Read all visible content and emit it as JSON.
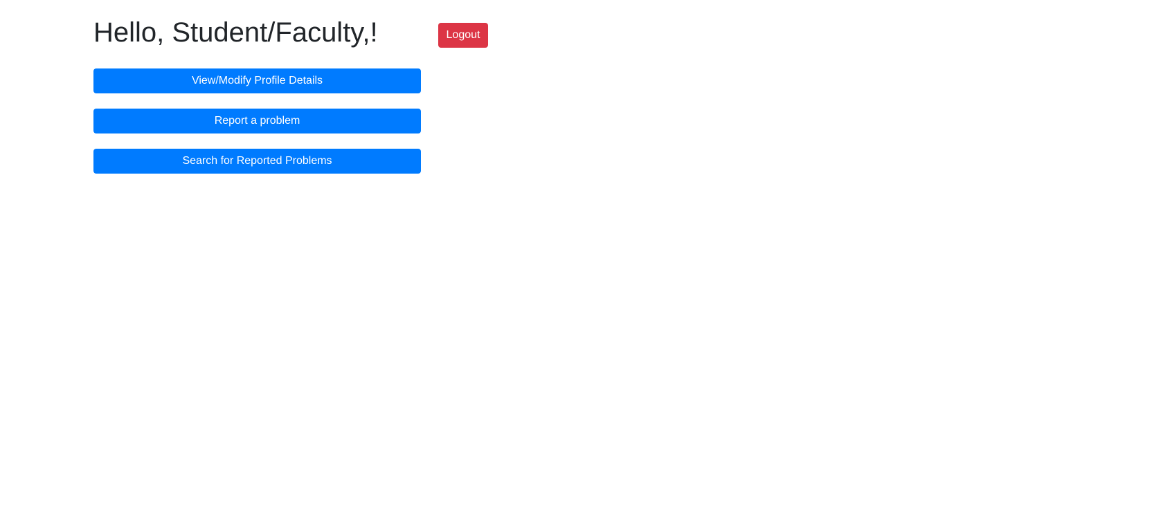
{
  "header": {
    "greeting": "Hello, Student/Faculty,!",
    "logout_label": "Logout"
  },
  "actions": [
    {
      "label": "View/Modify Profile Details"
    },
    {
      "label": "Report a problem"
    },
    {
      "label": "Search for Reported Problems"
    }
  ],
  "colors": {
    "primary": "#007bff",
    "danger": "#dc3545",
    "text": "#212529",
    "background": "#ffffff"
  }
}
